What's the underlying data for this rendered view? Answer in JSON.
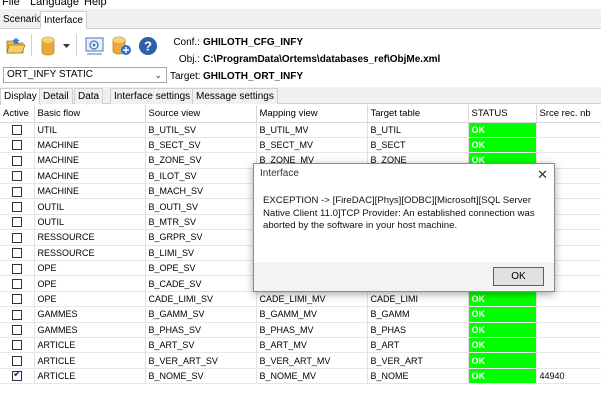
{
  "menu": [
    "File",
    "Language",
    "Help"
  ],
  "top_tabs": [
    "Scenario",
    "Interface"
  ],
  "info": {
    "conf_label": "Conf.:",
    "conf_value": "GHILOTH_CFG_INFY",
    "obj_label": "Obj.:",
    "obj_value": "C:\\ProgramData\\Ortems\\databases_ref\\ObjMe.xml",
    "target_label": "Target:",
    "target_value": "GHILOTH_ORT_INFY"
  },
  "combo": {
    "value": "ORT_INFY  STATIC"
  },
  "sub_tabs": [
    "Display",
    "Detail",
    "Data",
    "Interface settings",
    "Message settings"
  ],
  "columns": [
    "Active",
    "Basic flow",
    "Source view",
    "Mapping view",
    "Target table",
    "STATUS",
    "Srce rec. nb"
  ],
  "rows": [
    {
      "active": false,
      "flow": "UTIL",
      "source": "B_UTIL_SV",
      "mapping": "B_UTIL_MV",
      "target": "B_UTIL",
      "status": "OK",
      "nb": ""
    },
    {
      "active": false,
      "flow": "MACHINE",
      "source": "B_SECT_SV",
      "mapping": "B_SECT_MV",
      "target": "B_SECT",
      "status": "OK",
      "nb": ""
    },
    {
      "active": false,
      "flow": "MACHINE",
      "source": "B_ZONE_SV",
      "mapping": "B_ZONE_MV",
      "target": "B_ZONE",
      "status": "OK",
      "nb": ""
    },
    {
      "active": false,
      "flow": "MACHINE",
      "source": "B_ILOT_SV",
      "mapping": "",
      "target": "",
      "status": "",
      "nb": ""
    },
    {
      "active": false,
      "flow": "MACHINE",
      "source": "B_MACH_SV",
      "mapping": "",
      "target": "",
      "status": "",
      "nb": ""
    },
    {
      "active": false,
      "flow": "OUTIL",
      "source": "B_OUTI_SV",
      "mapping": "",
      "target": "",
      "status": "",
      "nb": ""
    },
    {
      "active": false,
      "flow": "OUTIL",
      "source": "B_MTR_SV",
      "mapping": "",
      "target": "",
      "status": "",
      "nb": ""
    },
    {
      "active": false,
      "flow": "RESSOURCE",
      "source": "B_GRPR_SV",
      "mapping": "",
      "target": "",
      "status": "",
      "nb": ""
    },
    {
      "active": false,
      "flow": "RESSOURCE",
      "source": "B_LIMI_SV",
      "mapping": "",
      "target": "",
      "status": "",
      "nb": ""
    },
    {
      "active": false,
      "flow": "OPE",
      "source": "B_OPE_SV",
      "mapping": "",
      "target": "",
      "status": "",
      "nb": ""
    },
    {
      "active": false,
      "flow": "OPE",
      "source": "B_CADE_SV",
      "mapping": "",
      "target": "",
      "status": "",
      "nb": ""
    },
    {
      "active": false,
      "flow": "OPE",
      "source": "CADE_LIMI_SV",
      "mapping": "CADE_LIMI_MV",
      "target": "CADE_LIMI",
      "status": "OK",
      "nb": ""
    },
    {
      "active": false,
      "flow": "GAMMES",
      "source": "B_GAMM_SV",
      "mapping": "B_GAMM_MV",
      "target": "B_GAMM",
      "status": "OK",
      "nb": ""
    },
    {
      "active": false,
      "flow": "GAMMES",
      "source": "B_PHAS_SV",
      "mapping": "B_PHAS_MV",
      "target": "B_PHAS",
      "status": "OK",
      "nb": ""
    },
    {
      "active": false,
      "flow": "ARTICLE",
      "source": "B_ART_SV",
      "mapping": "B_ART_MV",
      "target": "B_ART",
      "status": "OK",
      "nb": ""
    },
    {
      "active": false,
      "flow": "ARTICLE",
      "source": "B_VER_ART_SV",
      "mapping": "B_VER_ART_MV",
      "target": "B_VER_ART",
      "status": "OK",
      "nb": ""
    },
    {
      "active": true,
      "flow": "ARTICLE",
      "source": "B_NOME_SV",
      "mapping": "B_NOME_MV",
      "target": "B_NOME",
      "status": "OK",
      "nb": "44940"
    }
  ],
  "dialog": {
    "title": "Interface",
    "message": "EXCEPTION -> [FireDAC][Phys][ODBC][Microsoft][SQL Server Native Client 11.0]TCP Provider: An established connection was aborted by the software in your host machine.",
    "ok_label": "OK"
  },
  "colors": {
    "status_ok": "#00ff00",
    "accent": "#0078d7"
  },
  "icons": [
    "open-folder-icon",
    "database-icon",
    "dropdown-arrow-icon",
    "settings-map-icon",
    "database-add-icon",
    "help-icon",
    "close-icon",
    "checkbox-icon"
  ]
}
